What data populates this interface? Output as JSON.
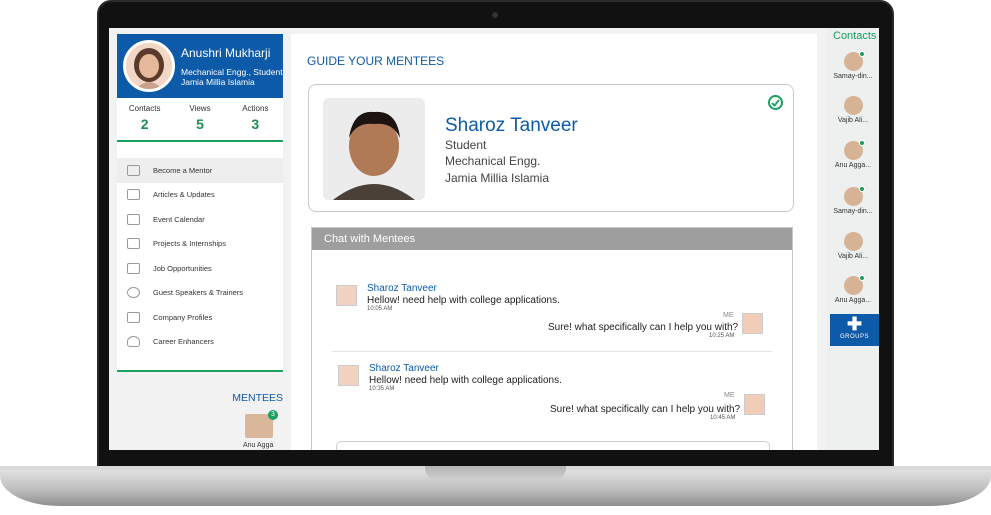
{
  "profile": {
    "name": "Anushri Mukharji",
    "dept": "Mechanical Engg., Student",
    "college": "Jamia Millia Islamia"
  },
  "stats": [
    {
      "label": "Contacts",
      "value": "2"
    },
    {
      "label": "Views",
      "value": "5"
    },
    {
      "label": "Actions",
      "value": "3"
    }
  ],
  "menu": [
    {
      "label": "Become a Mentor",
      "icon": "mentor-icon"
    },
    {
      "label": "Articles & Updates",
      "icon": "edit-icon"
    },
    {
      "label": "Event Calendar",
      "icon": "calendar-icon"
    },
    {
      "label": "Projects & Internships",
      "icon": "document-icon"
    },
    {
      "label": "Job Opportunities",
      "icon": "briefcase-icon"
    },
    {
      "label": "Guest Speakers & Trainers",
      "icon": "speaker-icon"
    },
    {
      "label": "Company Profiles",
      "icon": "building-icon"
    },
    {
      "label": "Career Enhancers",
      "icon": "lightbulb-icon"
    }
  ],
  "mentees": {
    "title": "MENTEES",
    "items": [
      {
        "name": "Anu Agga",
        "count": "3"
      }
    ]
  },
  "main": {
    "title": "GUIDE YOUR MENTEES",
    "mentee_card": {
      "name": "Sharoz Tanveer",
      "role": "Student",
      "dept": "Mechanical Engg.",
      "college": "Jamia Millia Islamia"
    }
  },
  "chat": {
    "title": "Chat with Mentees",
    "threads": [
      {
        "sender": "Sharoz Tanveer",
        "message": "Hellow! need help with college applications.",
        "time": "10:05 AM",
        "me_label": "ME",
        "reply": "Sure! what specifically can I help you with?",
        "reply_time": "10:25 AM"
      },
      {
        "sender": "Sharoz Tanveer",
        "message": "Hellow! need help with college applications.",
        "time": "10:35 AM",
        "me_label": "ME",
        "reply": "Sure! what specifically can I help you with?",
        "reply_time": "10:45 AM"
      }
    ]
  },
  "contacts": {
    "title": "Contacts",
    "items": [
      "Samay-din...",
      "Vajib Ali...",
      "Anu Agga...",
      "Samay-din...",
      "Vajib Ali...",
      "Anu Agga..."
    ],
    "groups_label": "GROUPS"
  }
}
